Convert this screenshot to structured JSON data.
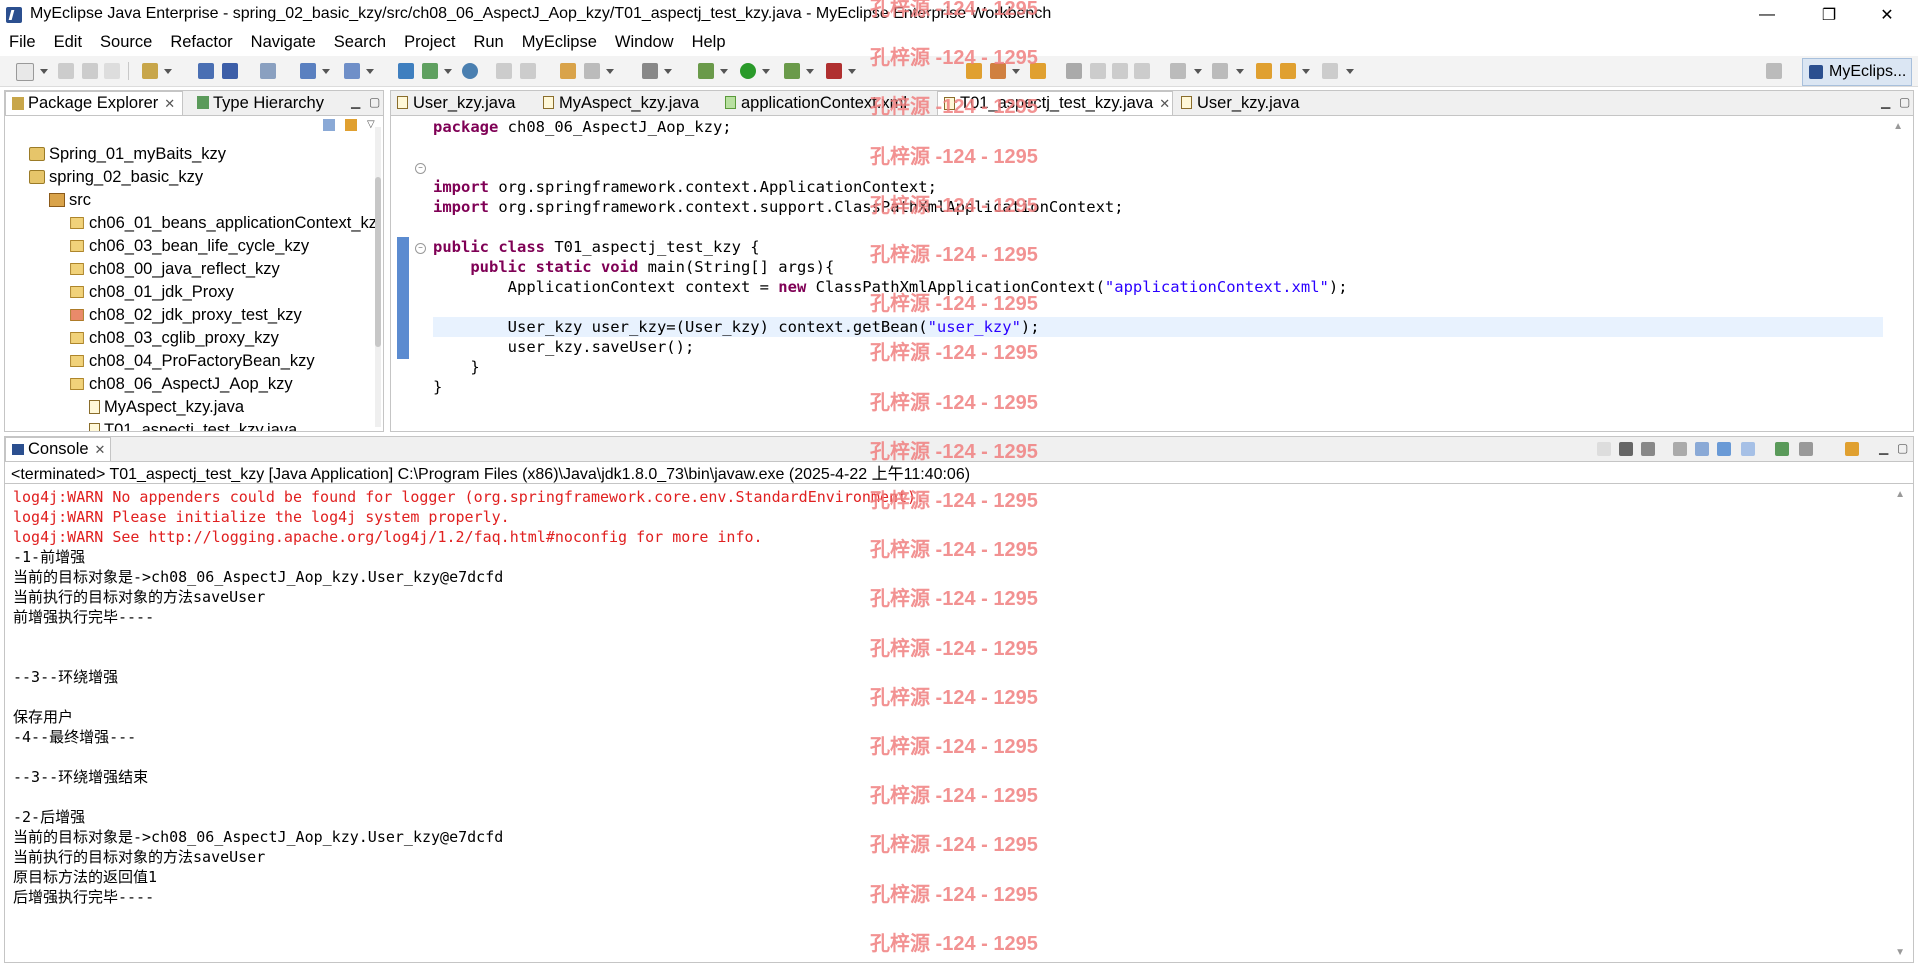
{
  "window": {
    "title": "MyEclipse Java Enterprise - spring_02_basic_kzy/src/ch08_06_AspectJ_Aop_kzy/T01_aspectj_test_kzy.java - MyEclipse Enterprise Workbench",
    "minimize": "—",
    "restore": "❐",
    "close": "✕"
  },
  "menu": [
    "File",
    "Edit",
    "Source",
    "Refactor",
    "Navigate",
    "Search",
    "Project",
    "Run",
    "MyEclipse",
    "Window",
    "Help"
  ],
  "perspective": {
    "label": "MyEclips..."
  },
  "explorer": {
    "tabs": [
      {
        "label": "Package Explorer",
        "close": "✕"
      },
      {
        "label": "Type Hierarchy"
      }
    ],
    "items": [
      "Spring_01_myBaits_kzy",
      "spring_02_basic_kzy",
      "src",
      "ch06_01_beans_applicationContext_kz",
      "ch06_03_bean_life_cycle_kzy",
      "ch08_00_java_reflect_kzy",
      "ch08_01_jdk_Proxy",
      "ch08_02_jdk_proxy_test_kzy",
      "ch08_03_cglib_proxy_kzy",
      "ch08_04_ProFactoryBean_kzy",
      "ch08_06_AspectJ_Aop_kzy",
      "MyAspect_kzy.java",
      "T01_aspectj_test_kzy.java"
    ]
  },
  "editor": {
    "tabs": [
      {
        "label": "User_kzy.java"
      },
      {
        "label": "MyAspect_kzy.java"
      },
      {
        "label": "applicationContext.xml"
      },
      {
        "label": "T01_aspectj_test_kzy.java",
        "close": "✕"
      },
      {
        "label": "User_kzy.java"
      }
    ],
    "code": {
      "l1_kw": "package",
      "l1_rest": " ch08_06_AspectJ_Aop_kzy;",
      "l3_kw": "import",
      "l3_rest": " org.springframework.context.ApplicationContext;",
      "l4_kw": "import",
      "l4_rest": " org.springframework.context.support.ClassPathXmlApplicationContext;",
      "l6_kw": "public class",
      "l6_rest": " T01_aspectj_test_kzy {",
      "l7_kw": "    public static void",
      "l7_rest": " main(String[] args){",
      "l8_a": "        ApplicationContext context = ",
      "l8_kw": "new",
      "l8_b": " ClassPathXmlApplicationContext(",
      "l8_str": "\"applicationContext.xml\"",
      "l8_c": ");",
      "l10_a": "        User_kzy user_kzy=(User_kzy) context.getBean(",
      "l10_str": "\"user_kzy\"",
      "l10_c": ");",
      "l11": "        user_kzy.saveUser();",
      "l12": "    }",
      "l13": "}"
    }
  },
  "console": {
    "tab": {
      "label": "Console",
      "close": "✕"
    },
    "info": "<terminated> T01_aspectj_test_kzy [Java Application] C:\\Program Files (x86)\\Java\\jdk1.8.0_73\\bin\\javaw.exe (2025-4-22 上午11:40:06)",
    "lines": [
      {
        "text": "log4j:WARN No appenders could be found for logger (org.springframework.core.env.StandardEnvironment).",
        "color": "red"
      },
      {
        "text": "log4j:WARN Please initialize the log4j system properly.",
        "color": "red"
      },
      {
        "text": "log4j:WARN See http://logging.apache.org/log4j/1.2/faq.html#noconfig for more info.",
        "color": "red"
      },
      {
        "text": "-1-前增强",
        "color": "black"
      },
      {
        "text": "当前的目标对象是->ch08_06_AspectJ_Aop_kzy.User_kzy@e7dcfd",
        "color": "black"
      },
      {
        "text": "当前执行的目标对象的方法saveUser",
        "color": "black"
      },
      {
        "text": "前增强执行完毕----",
        "color": "black"
      },
      {
        "text": "",
        "color": "black"
      },
      {
        "text": "",
        "color": "black"
      },
      {
        "text": "--3--环绕增强",
        "color": "black"
      },
      {
        "text": "",
        "color": "black"
      },
      {
        "text": "保存用户",
        "color": "black"
      },
      {
        "text": "-4--最终增强---",
        "color": "black"
      },
      {
        "text": "",
        "color": "black"
      },
      {
        "text": "--3--环绕增强结束",
        "color": "black"
      },
      {
        "text": "",
        "color": "black"
      },
      {
        "text": "-2-后增强",
        "color": "black"
      },
      {
        "text": "当前的目标对象是->ch08_06_AspectJ_Aop_kzy.User_kzy@e7dcfd",
        "color": "black"
      },
      {
        "text": "当前执行的目标对象的方法saveUser",
        "color": "black"
      },
      {
        "text": "原目标方法的返回值1",
        "color": "black"
      },
      {
        "text": "后增强执行完毕----",
        "color": "black"
      }
    ]
  },
  "watermark": {
    "text": "孔梓源 -124 - 1295",
    "count": 20
  },
  "colors": {
    "keyword": "#7f0055",
    "string": "#2a00ff",
    "console_red": "#e02020",
    "watermark": "#f08080"
  }
}
